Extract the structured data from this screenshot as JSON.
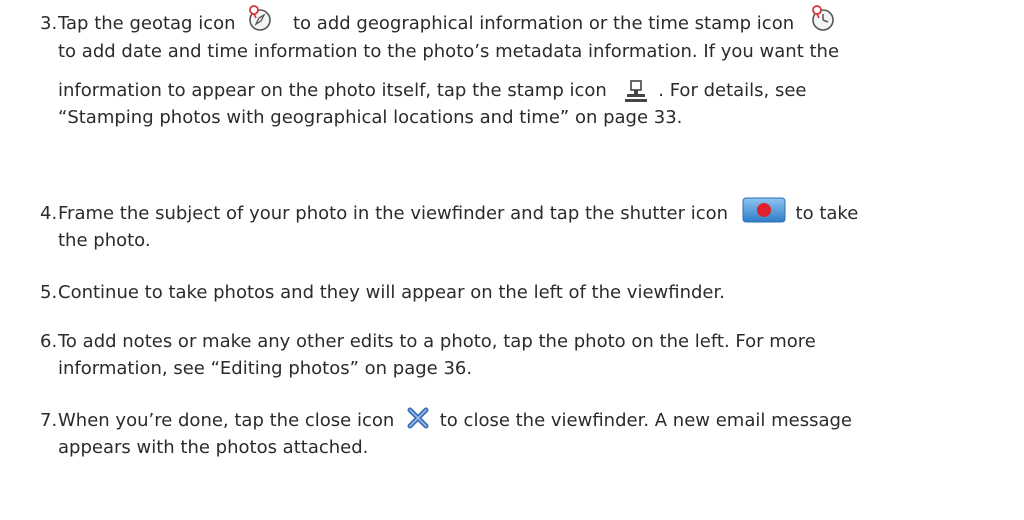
{
  "steps": [
    {
      "number": "3.",
      "segments": {
        "t1": "Tap the geotag icon",
        "t2": "to add geographical information or the time stamp icon",
        "t3": "to add date and time information to the photo’s metadata information. If you want the",
        "t4": "information to appear on the photo itself, tap the stamp icon",
        "t5": ". For details, see",
        "t6": "“Stamping photos with geographical locations and time” on page 33."
      },
      "icons": [
        "geotag-icon",
        "time-stamp-icon",
        "stamp-icon"
      ]
    },
    {
      "number": "4.",
      "segments": {
        "t1": "Frame the subject of your photo in the viewfinder and tap the shutter icon",
        "t2": "to take",
        "t3": "the photo."
      },
      "icons": [
        "shutter-icon"
      ]
    },
    {
      "number": "5.",
      "segments": {
        "t1": "Continue to take photos and they will appear on the left of the viewfinder."
      }
    },
    {
      "number": "6.",
      "segments": {
        "t1": "To add notes or make any other edits to a photo, tap the photo on the left. For more",
        "t2": "information, see “Editing photos” on page 36."
      }
    },
    {
      "number": "7.",
      "segments": {
        "t1": "When you’re done, tap the close icon",
        "t2": "to close the viewfinder. A new email message",
        "t3": "appears with the photos attached."
      },
      "icons": [
        "close-icon"
      ]
    }
  ],
  "colors": {
    "text": "#2b2b2b",
    "icon_red": "#d9343a",
    "shutter_blue": "#3f8fd6",
    "close_blue": "#3d6fb8"
  }
}
